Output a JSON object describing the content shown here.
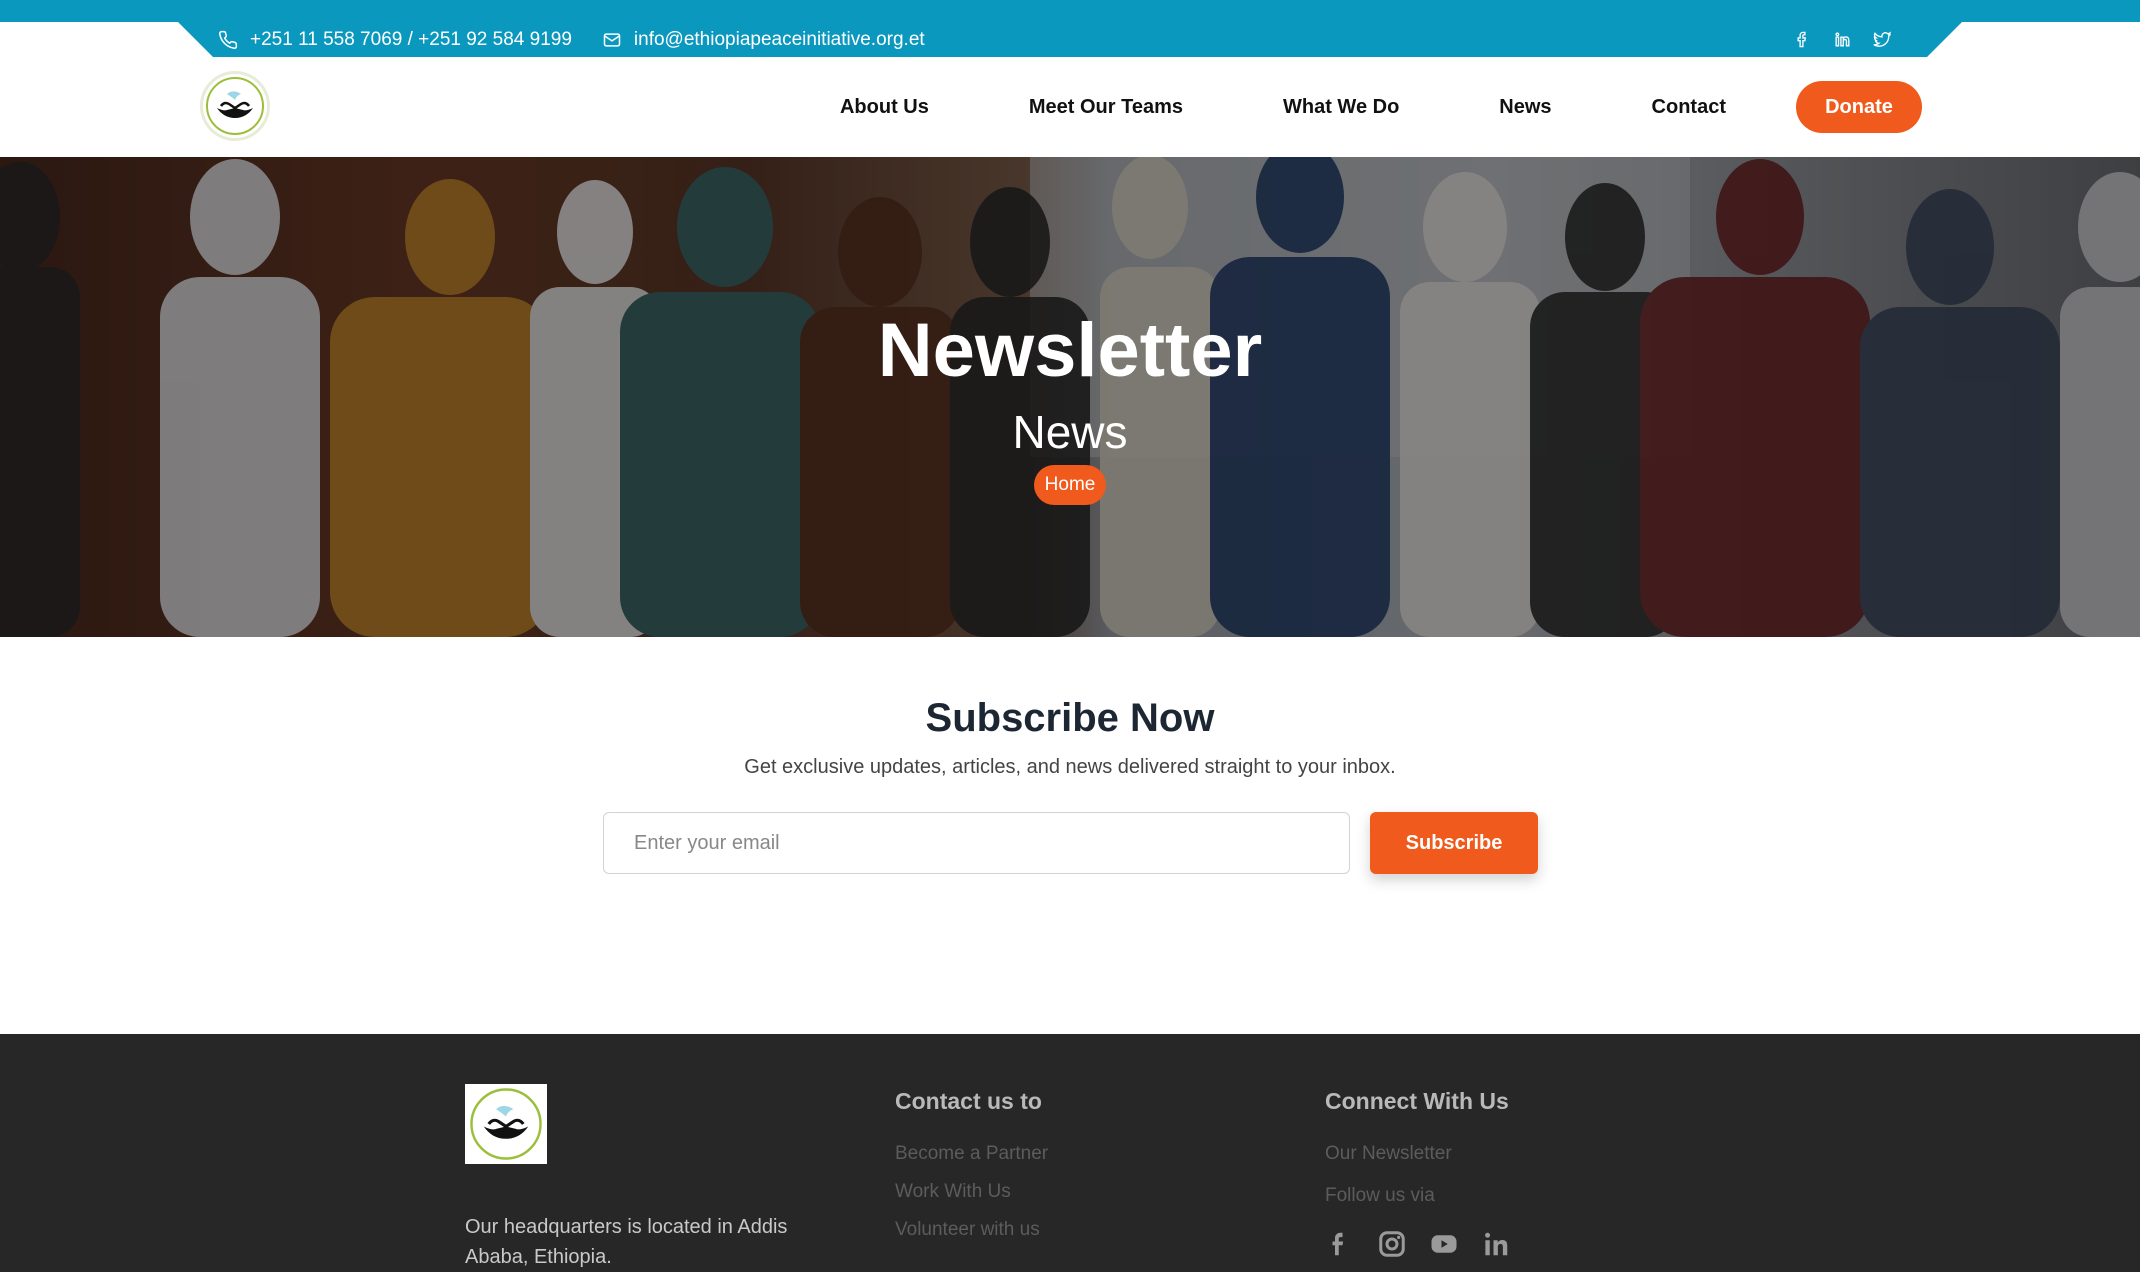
{
  "topbar": {
    "phone": "+251 11 558 7069 / +251 92 584 9199",
    "email": "info@ethiopiapeaceinitiative.org.et",
    "social_icons": [
      "facebook-icon",
      "linkedin-icon",
      "twitter-icon"
    ]
  },
  "nav": {
    "items": [
      {
        "label": "About Us"
      },
      {
        "label": "Meet Our Teams"
      },
      {
        "label": "What We Do"
      },
      {
        "label": "News"
      },
      {
        "label": "Contact"
      }
    ],
    "donate_label": "Donate"
  },
  "hero": {
    "title": "Newsletter",
    "subtitle": "News",
    "breadcrumb": "Home"
  },
  "subscribe": {
    "title": "Subscribe Now",
    "description": "Get exclusive updates, articles, and news delivered straight to your inbox.",
    "email_placeholder": "Enter your email",
    "button_label": "Subscribe"
  },
  "footer": {
    "headquarters": "Our headquarters is located in Addis Ababa, Ethiopia.",
    "contact": {
      "title": "Contact us to",
      "links": [
        "Become a Partner",
        "Work With Us",
        "Volunteer with us"
      ]
    },
    "connect": {
      "title": "Connect With Us",
      "newsletter": "Our Newsletter",
      "follow": "Follow us via",
      "social_icons": [
        "facebook-icon",
        "instagram-icon",
        "youtube-icon",
        "linkedin-icon"
      ]
    }
  },
  "colors": {
    "topbar": "#0b98be",
    "accent": "#f15a1d",
    "footer_bg": "#272727"
  }
}
